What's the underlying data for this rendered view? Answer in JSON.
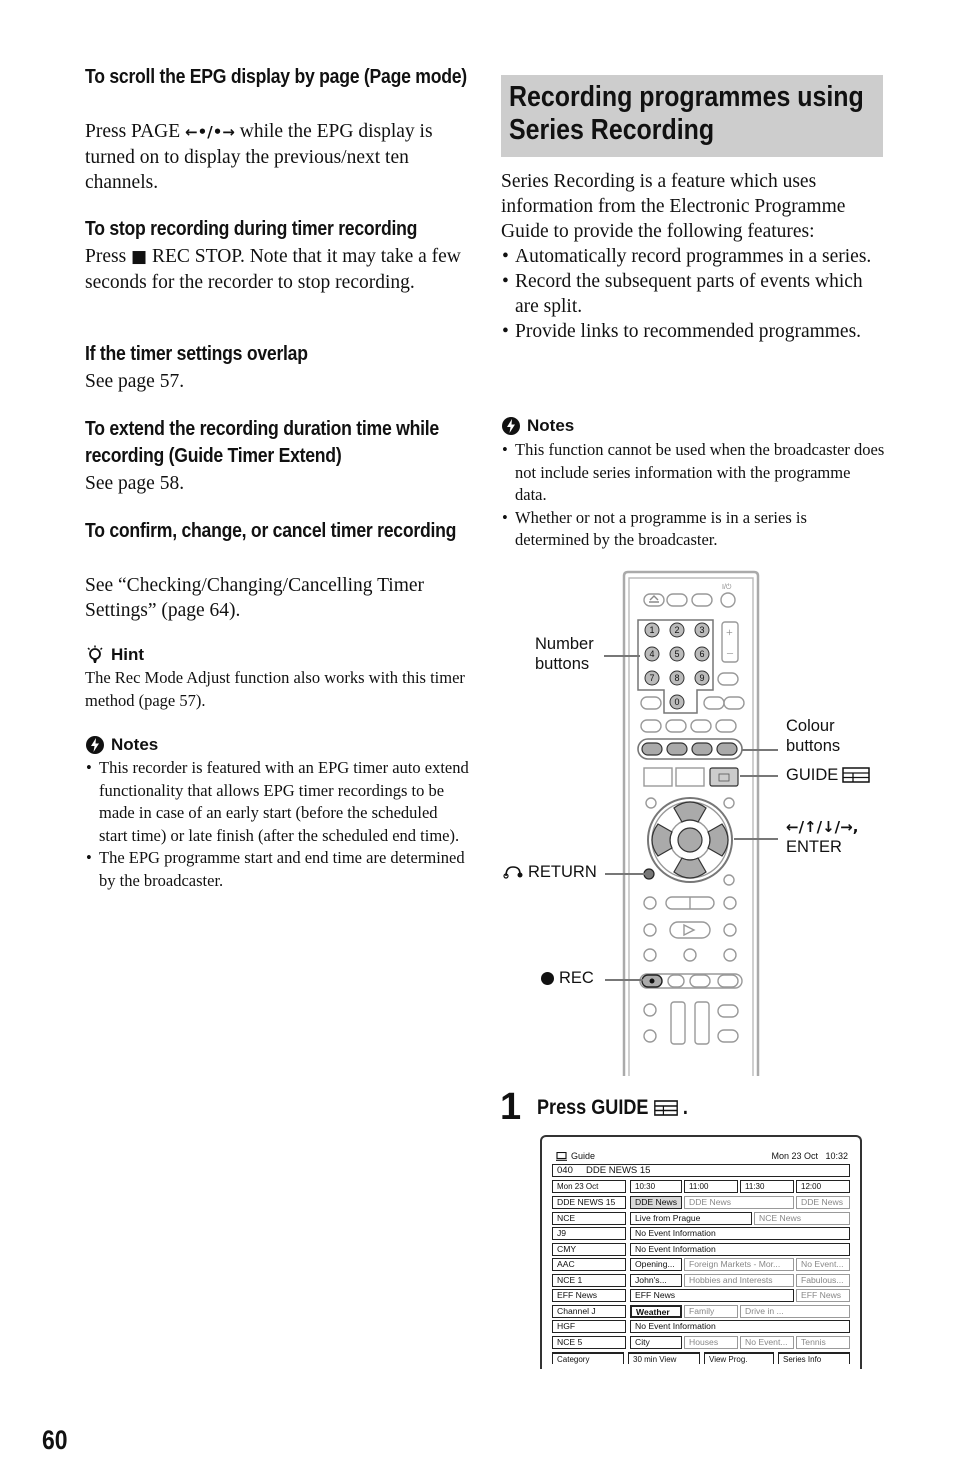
{
  "left_column": {
    "sections": [
      {
        "heading": "To scroll the EPG display by page (Page mode)",
        "body_pre": "Press PAGE ",
        "body_symbol": "←•/•→",
        "body_post": " while the EPG display is turned on to display the previous/next ten channels."
      },
      {
        "heading": "To stop recording during timer recording",
        "body_pre": "Press ",
        "body_symbol": "■",
        "body_post": " REC STOP. Note that it may take a few seconds for the recorder to stop recording."
      },
      {
        "heading": "If the timer settings overlap",
        "body": "See page 57."
      },
      {
        "heading": "To extend the recording duration time while recording (Guide Timer Extend)",
        "body": "See page 58."
      },
      {
        "heading": "To confirm, change, or cancel timer recording",
        "body": "See “Checking/Changing/Cancelling Timer Settings” (page 64)."
      }
    ],
    "hint": {
      "icon": "lightbulb-icon",
      "title": "Hint",
      "text": "The Rec Mode Adjust function also works with this timer method (page 57)."
    },
    "notes": {
      "icon": "notes-icon",
      "title": "Notes",
      "items": [
        "This recorder is featured with an EPG timer auto extend functionality that allows EPG timer recordings to be made in case of an early start (before the scheduled start time) or late finish (after the scheduled end time).",
        "The EPG programme start and end time are determined by the broadcaster."
      ]
    }
  },
  "right_column": {
    "section_title": "Recording programmes using Series Recording",
    "intro": "Series Recording is a feature which uses information from the Electronic Programme Guide to provide the following features:",
    "features": [
      "Automatically record programmes in a series.",
      "Record the subsequent parts of events which are split.",
      "Provide links to recommended programmes."
    ],
    "notes": {
      "title": "Notes",
      "items": [
        "This function cannot be used when the broadcaster does not include series information with the programme data.",
        "Whether or not a programme is in a series is determined by the broadcaster."
      ]
    },
    "remote_callouts": {
      "number_buttons": "Number buttons",
      "colour_buttons": "Colour buttons",
      "guide": "GUIDE",
      "arrows": "←/↑/↓/→,",
      "enter": "ENTER",
      "return": "RETURN",
      "rec": "REC",
      "number_keys": [
        "1",
        "2",
        "3",
        "4",
        "5",
        "6",
        "7",
        "8",
        "9",
        "0"
      ]
    },
    "step": {
      "number": "1",
      "text": "Press GUIDE",
      "suffix": "."
    },
    "guide_screen": {
      "title": "Guide",
      "datetime": "Mon 23 Oct   10:32",
      "channel_bar": "040     DDE NEWS 15",
      "date_label": "Mon 23 Oct",
      "times": [
        "10:30",
        "11:00",
        "11:30",
        "12:00"
      ],
      "rows": [
        {
          "channel": "DDE NEWS 15",
          "programmes": [
            {
              "title": "DDE News",
              "state": "selected"
            },
            {
              "title": "DDE News",
              "state": "dim"
            },
            {
              "title": "DDE News",
              "state": "dim"
            }
          ]
        },
        {
          "channel": "NCE",
          "programmes": [
            {
              "title": "Live from Prague",
              "state": "normal"
            },
            {
              "title": "NCE News",
              "state": "dim"
            }
          ]
        },
        {
          "channel": "J9",
          "programmes": [
            {
              "title": "No Event Information",
              "state": "normal"
            }
          ]
        },
        {
          "channel": "CMY",
          "programmes": [
            {
              "title": "No Event Information",
              "state": "normal"
            }
          ]
        },
        {
          "channel": "AAC",
          "programmes": [
            {
              "title": "Opening...",
              "state": "normal"
            },
            {
              "title": "Foreign Markets - Mor...",
              "state": "dim"
            },
            {
              "title": "No Event...",
              "state": "dim"
            }
          ]
        },
        {
          "channel": "NCE 1",
          "programmes": [
            {
              "title": "John's...",
              "state": "normal"
            },
            {
              "title": "Hobbies and Interests",
              "state": "dim"
            },
            {
              "title": "Fabulous...",
              "state": "dim"
            }
          ]
        },
        {
          "channel": "EFF News",
          "programmes": [
            {
              "title": "EFF News",
              "state": "normal"
            },
            {
              "title": "EFF News",
              "state": "dim"
            }
          ]
        },
        {
          "channel": "Channel J",
          "programmes": [
            {
              "title": "Weather",
              "state": "bold"
            },
            {
              "title": "Family",
              "state": "dim"
            },
            {
              "title": "Drive in ...",
              "state": "dim"
            }
          ]
        },
        {
          "channel": "HGF",
          "programmes": [
            {
              "title": "No Event Information",
              "state": "normal"
            }
          ]
        },
        {
          "channel": "NCE 5",
          "programmes": [
            {
              "title": "City",
              "state": "normal"
            },
            {
              "title": "Houses",
              "state": "dim"
            },
            {
              "title": "No Event...",
              "state": "dim"
            },
            {
              "title": "Tennis",
              "state": "dim"
            }
          ]
        }
      ],
      "tabs": [
        "Category",
        "30 min View",
        "View Prog.",
        "Series Info"
      ]
    }
  },
  "page_number": "60"
}
